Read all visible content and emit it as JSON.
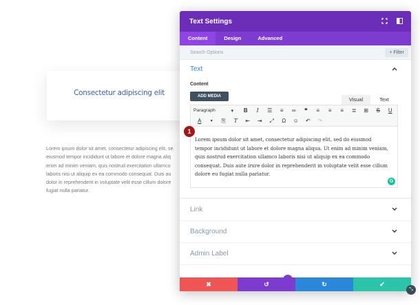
{
  "background": {
    "card_heading": "Consectetur adipiscing elit",
    "paragraph_lines": [
      "Lorem ipsum dolor sit amet, consectetur adipiscing elit, se",
      "eiusmod tempor incididunt ut labore et dolore magna aliq",
      "enim ad minim veniam, quis nostrud exercitation ullamco",
      "laboris nisi ut aliquip ex ea commodo consequat. Duis au",
      "dolor in reprehenderit in voluptate velit esse cillum dolore",
      "fugiat nulla pariatur."
    ]
  },
  "modal": {
    "title": "Text Settings",
    "header_icons": [
      "expand-icon",
      "sidebar-toggle-icon"
    ],
    "tabs": [
      {
        "label": "Content",
        "active": true
      },
      {
        "label": "Design",
        "active": false
      },
      {
        "label": "Advanced",
        "active": false
      }
    ],
    "search": {
      "placeholder": "Search Options",
      "filter_label": "+ Filter"
    },
    "text_section": {
      "title": "Text",
      "content_label": "Content",
      "add_media_label": "ADD MEDIA",
      "editor_tabs": {
        "visual": "Visual",
        "text": "Text"
      },
      "format_select": "Paragraph",
      "body_lines": [
        "Lorem ipsum dolor sit amet, consectetur adipiscing elit, sed do eiusmod",
        "tempor incididunt ut labore et dolore magna aliqua. Ut enim ad minim veniam,",
        "quis nostrud exercitation ullamco laboris nisi ut aliquip ex ea commodo",
        "consequat. Duis aute irure dolor in reprehenderit in voluptate velit esse cillum",
        "dolore eu fugiat nulla pariatur."
      ]
    },
    "collapsed_sections": [
      {
        "title": "Link"
      },
      {
        "title": "Background"
      },
      {
        "title": "Admin Label"
      }
    ]
  },
  "step_badge": "1",
  "footer": {
    "colors": {
      "cancel": "#ef5555",
      "undo": "#7e3bd0",
      "redo": "#2b87da",
      "save": "#29c4a9"
    }
  },
  "colors": {
    "header": "#6c2eb9",
    "tabs": "#7e3bd0",
    "accent": "#2b87da"
  }
}
